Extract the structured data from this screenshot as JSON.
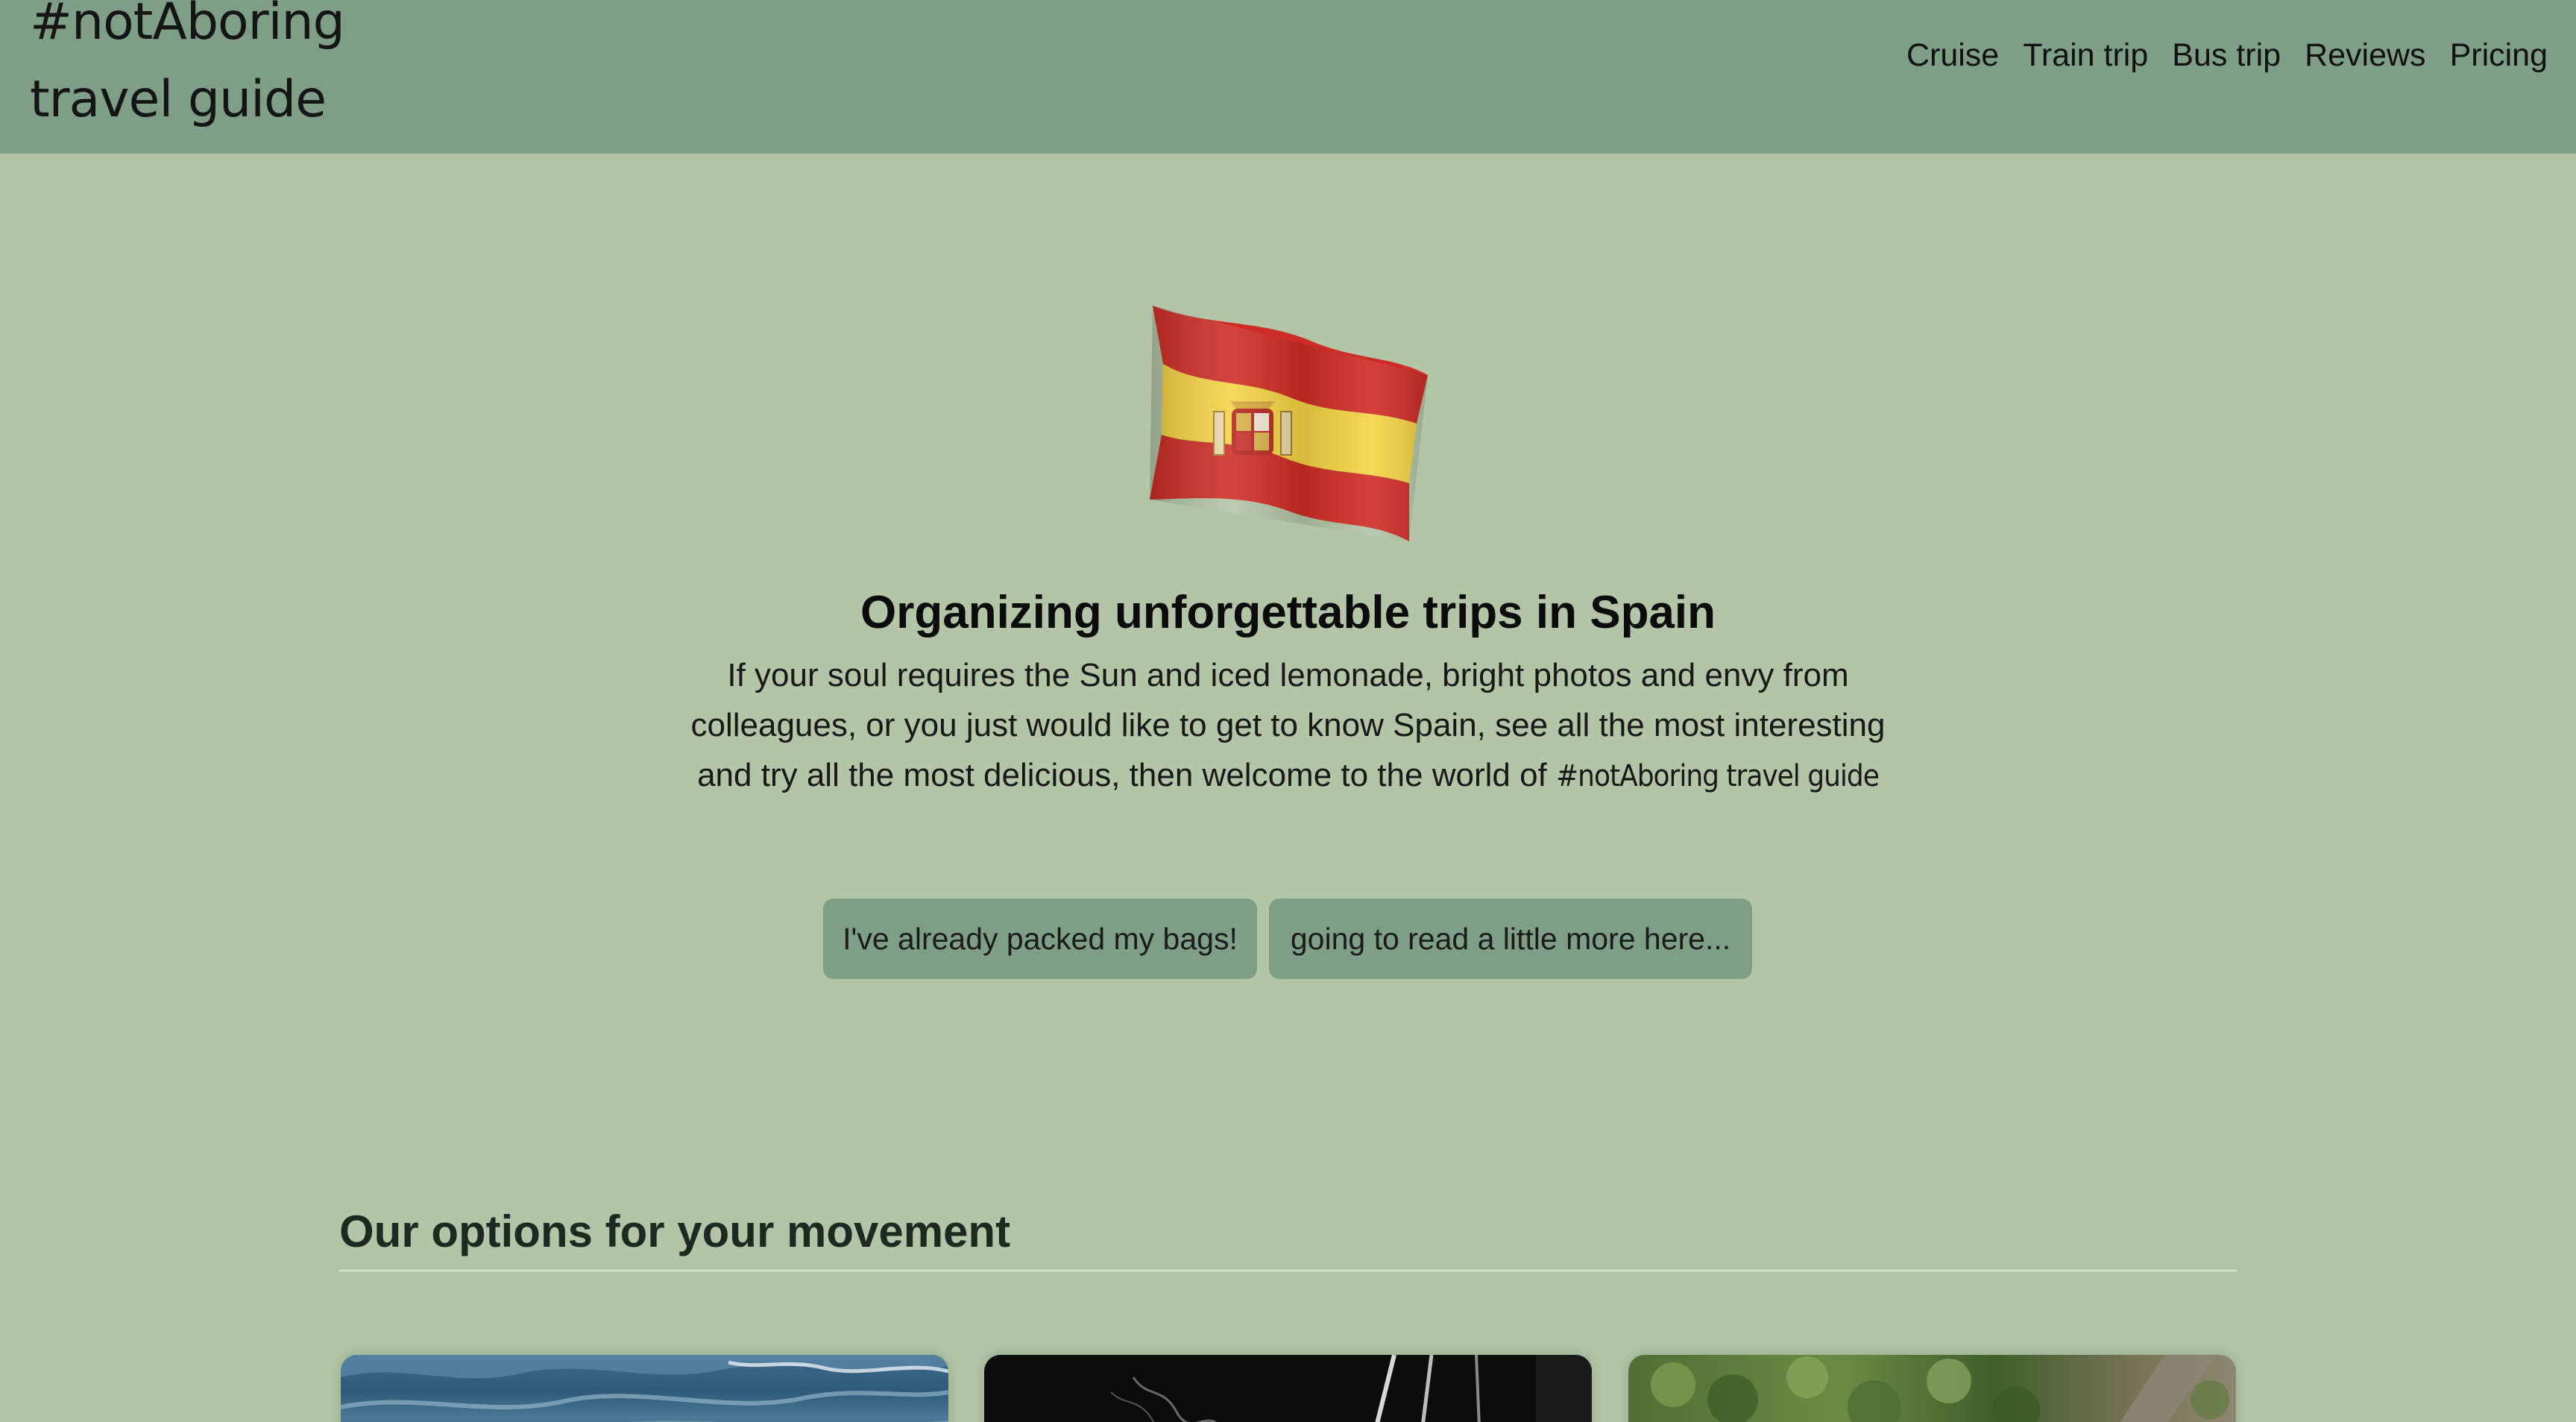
{
  "header": {
    "brand_line1": "#notAboring",
    "brand_line2": "travel guide",
    "nav": [
      {
        "label": "Cruise"
      },
      {
        "label": "Train trip"
      },
      {
        "label": "Bus trip"
      },
      {
        "label": "Reviews"
      },
      {
        "label": "Pricing"
      }
    ]
  },
  "hero": {
    "flag_icon": "spain-flag-icon",
    "title": "Organizing unforgettable trips in Spain",
    "text": "If your soul requires the Sun and iced lemonade, bright photos and envy from colleagues, or you just would like to get to know Spain, see all the most interesting and try all the most delicious, then welcome to the world of",
    "brand_tag": "#notAboring travel guide",
    "buttons": {
      "primary": "I've already packed my bags!",
      "secondary": "going to read a little more here..."
    }
  },
  "options": {
    "title": "Our options for your movement",
    "cards": [
      {
        "image": "sea-waves-image"
      },
      {
        "image": "railway-tracks-image"
      },
      {
        "image": "forest-road-aerial-image"
      }
    ]
  },
  "colors": {
    "page_bg": "#b2c5a6",
    "header_bg": "#7f9e86",
    "button_bg": "#7f9e86",
    "flag_red": "#c8261f",
    "flag_yellow": "#f2d13a"
  }
}
